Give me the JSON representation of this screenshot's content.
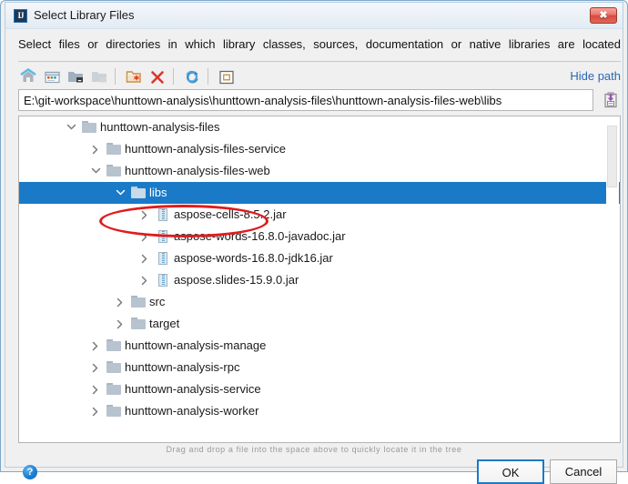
{
  "window": {
    "title": "Select Library Files",
    "app_icon": "IJ",
    "close_label": "✖",
    "frame_color": "#7fa8cc"
  },
  "description": "Select files or directories in which library classes, sources, documentation or native libraries are located",
  "toolbar": {
    "buttons": [
      {
        "name": "home-icon",
        "tooltip": "Home"
      },
      {
        "name": "desktop-icon",
        "tooltip": "Desktop"
      },
      {
        "name": "project-folder-icon",
        "tooltip": "Project Directory"
      },
      {
        "name": "module-folder-icon",
        "tooltip": "Module Directory"
      },
      {
        "name": "new-folder-icon",
        "tooltip": "New Folder"
      },
      {
        "name": "delete-icon",
        "tooltip": "Delete"
      },
      {
        "name": "refresh-icon",
        "tooltip": "Refresh"
      },
      {
        "name": "show-hidden-icon",
        "tooltip": "Show Hidden Files"
      }
    ],
    "hide_path_label": "Hide path",
    "hide_path_color": "#2a66b5"
  },
  "path": {
    "value": "E:\\git-workspace\\hunttown-analysis\\hunttown-analysis-files\\hunttown-analysis-files-web\\libs",
    "placeholder": "",
    "paste_icon": "paste-icon"
  },
  "tree": {
    "selection_color": "#1a7ac7",
    "rows": [
      {
        "label": "hunttown-analysis-files",
        "depth": 2,
        "type": "folder",
        "state": "expanded",
        "selected": false
      },
      {
        "label": "hunttown-analysis-files-service",
        "depth": 3,
        "type": "folder",
        "state": "collapsed",
        "selected": false
      },
      {
        "label": "hunttown-analysis-files-web",
        "depth": 3,
        "type": "folder",
        "state": "expanded",
        "selected": false
      },
      {
        "label": "libs",
        "depth": 4,
        "type": "folder",
        "state": "expanded",
        "selected": true
      },
      {
        "label": "aspose-cells-8.5.2.jar",
        "depth": 5,
        "type": "jar",
        "state": "collapsed",
        "selected": false
      },
      {
        "label": "aspose-words-16.8.0-javadoc.jar",
        "depth": 5,
        "type": "jar",
        "state": "collapsed",
        "selected": false
      },
      {
        "label": "aspose-words-16.8.0-jdk16.jar",
        "depth": 5,
        "type": "jar",
        "state": "collapsed",
        "selected": false
      },
      {
        "label": "aspose.slides-15.9.0.jar",
        "depth": 5,
        "type": "jar",
        "state": "collapsed",
        "selected": false
      },
      {
        "label": "src",
        "depth": 4,
        "type": "folder",
        "state": "collapsed",
        "selected": false
      },
      {
        "label": "target",
        "depth": 4,
        "type": "folder",
        "state": "collapsed",
        "selected": false
      },
      {
        "label": "hunttown-analysis-manage",
        "depth": 3,
        "type": "folder",
        "state": "collapsed",
        "selected": false
      },
      {
        "label": "hunttown-analysis-rpc",
        "depth": 3,
        "type": "folder",
        "state": "collapsed",
        "selected": false
      },
      {
        "label": "hunttown-analysis-service",
        "depth": 3,
        "type": "folder",
        "state": "collapsed",
        "selected": false
      },
      {
        "label": "hunttown-analysis-worker",
        "depth": 3,
        "type": "folder",
        "state": "collapsed",
        "selected": false
      }
    ]
  },
  "annotation": {
    "shape": "ellipse",
    "color": "#e01b1b",
    "target": "libs"
  },
  "hint": "Drag and drop a file into the space above to quickly locate it in the tree",
  "footer": {
    "help_label": "?",
    "ok_label": "OK",
    "cancel_label": "Cancel",
    "focus_color": "#1a7ac7"
  }
}
